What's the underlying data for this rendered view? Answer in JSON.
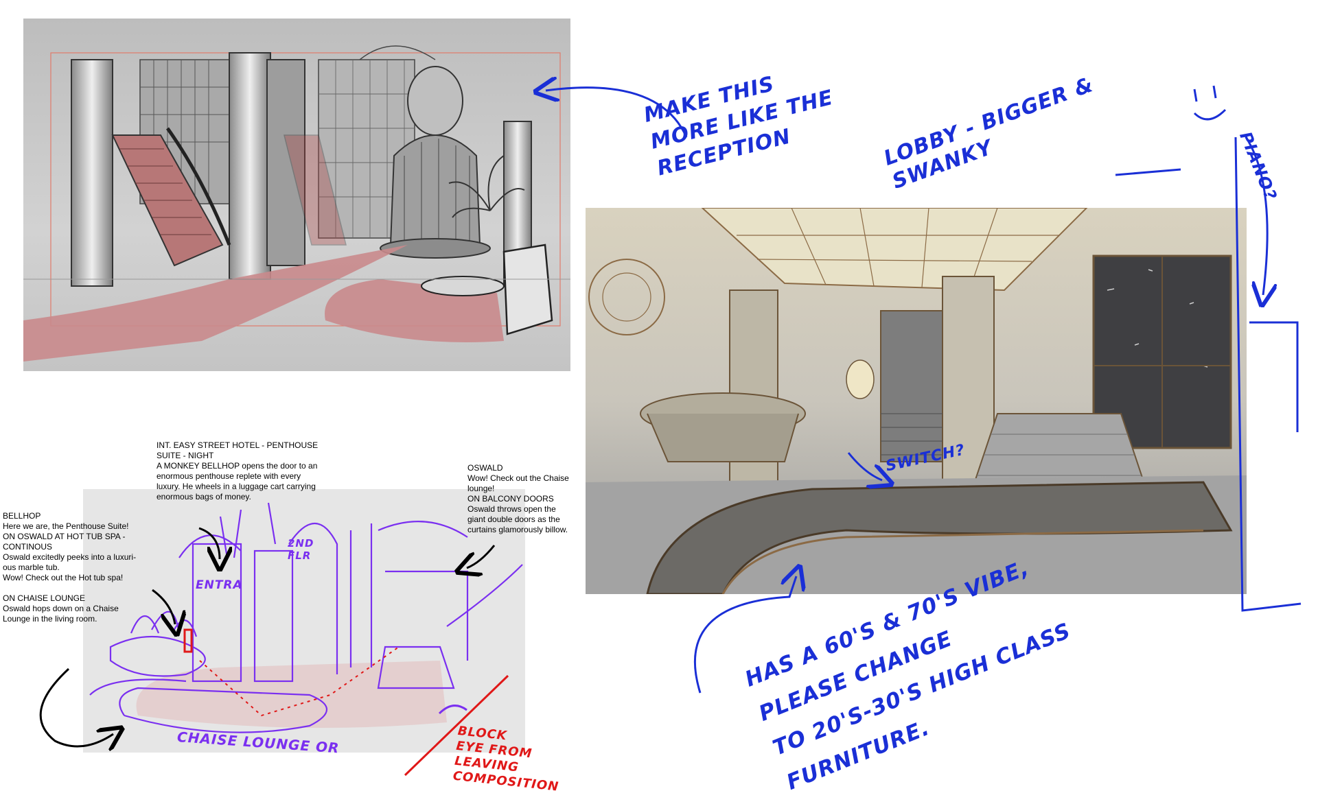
{
  "script": {
    "scene_heading": "INT. EASY STREET HOTEL - PENTHOUSE\nSUITE - NIGHT\nA MONKEY BELLHOP opens the door to an\nenormous penthouse replete with every\nluxury.  He wheels in a luggage cart carrying\nenormous bags of money.",
    "bellhop": "BELLHOP\nHere we are, the Penthouse Suite!\nON OSWALD AT HOT TUB SPA -\nCONTINOUS\nOswald excitedly peeks into a luxuri-\nous marble tub.\nWow! Check out the Hot tub spa!\n\nON CHAISE LOUNGE\nOswald hops down on a Chaise\nLounge in the living room.",
    "oswald": "OSWALD\nWow!  Check out the Chaise\nlounge!\nON BALCONY DOORS\nOswald throws open the\ngiant double doors as the\ncurtains glamorously billow."
  },
  "notes": {
    "make_this": "Make this\nmore like the\nreception",
    "lobby": "lobby - bigger &\nswanky",
    "piano": "piano?",
    "switch": "switch?",
    "vibe": "Has a 60's & 70's vibe,\nplease change\nto 20's-30's high class\nfurniture.",
    "chaise_lounge": "Chaise lounge or",
    "entra": "Entra",
    "second_floor": "2nd\nflr",
    "block_eye": "Block\neye from\nleaving\ncomposition"
  },
  "colors": {
    "blue_ink": "#1a2fd6",
    "purple_ink": "#7a2ff0",
    "red_ink": "#e01818",
    "carpet": "#c98a8c"
  },
  "icons": {
    "arrow_to_lobby": "curved-arrow-icon",
    "arrow_to_suite": "curved-arrow-icon",
    "arrow_to_piano": "arrow-down-icon"
  }
}
